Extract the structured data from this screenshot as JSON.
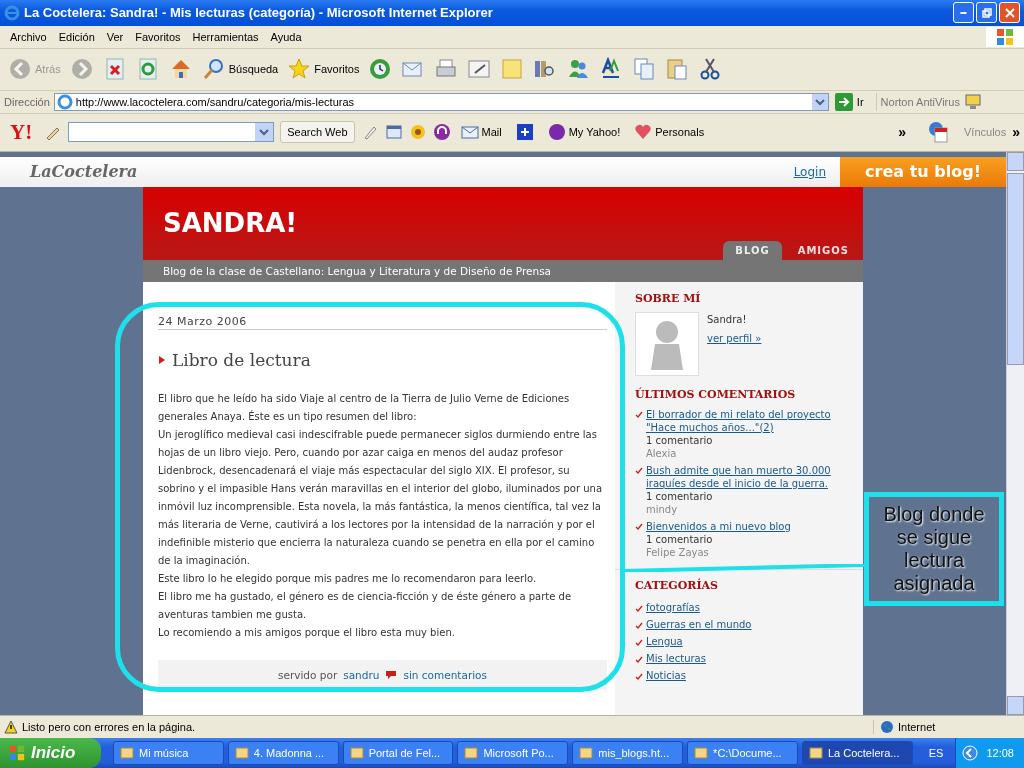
{
  "window": {
    "title": "La Coctelera: Sandra! - Mis lecturas (categoría) - Microsoft Internet Explorer"
  },
  "menu": [
    "Archivo",
    "Edición",
    "Ver",
    "Favoritos",
    "Herramientas",
    "Ayuda"
  ],
  "toolbar": [
    {
      "kind": "back",
      "label": "Atrás",
      "disabled": true
    },
    {
      "kind": "forward",
      "disabled": true
    },
    {
      "kind": "stop",
      "disabled": false
    },
    {
      "kind": "refresh",
      "disabled": false
    },
    {
      "kind": "home",
      "disabled": false
    },
    {
      "kind": "search",
      "label": "Búsqueda",
      "disabled": false
    },
    {
      "kind": "favorites",
      "label": "Favoritos",
      "disabled": false
    },
    {
      "kind": "history",
      "disabled": false
    },
    {
      "kind": "mail",
      "disabled": false
    },
    {
      "kind": "print",
      "disabled": false
    },
    {
      "kind": "edit",
      "disabled": false
    },
    {
      "kind": "note",
      "disabled": false
    },
    {
      "kind": "research",
      "disabled": false
    },
    {
      "kind": "messenger",
      "disabled": false
    },
    {
      "kind": "font",
      "disabled": false
    },
    {
      "kind": "copy",
      "disabled": false
    },
    {
      "kind": "paste",
      "disabled": false
    },
    {
      "kind": "cut",
      "disabled": false
    }
  ],
  "address": {
    "label": "Dirección",
    "url": "http://www.lacoctelera.com/sandru/categoria/mis-lecturas",
    "go": "Ir",
    "addon": "Norton AntiVirus"
  },
  "yahoo": {
    "logo": "Y!",
    "search_button": "Search Web",
    "items": [
      {
        "kind": "mail",
        "label": "Mail"
      },
      {
        "kind": "plus"
      },
      {
        "kind": "myyahoo",
        "label": "My Yahoo!"
      },
      {
        "kind": "personals",
        "label": "Personals"
      }
    ],
    "more": "»",
    "links": "Vínculos",
    "links_more": "»"
  },
  "site": {
    "logo": "LaCoctelera",
    "login": "Login",
    "cta": "crea tu blog!"
  },
  "blog": {
    "title": "SANDRA!",
    "tabs": [
      {
        "label": "BLOG",
        "selected": true
      },
      {
        "label": "AMIGOS",
        "selected": false
      }
    ],
    "subtitle": "Blog de la clase de Castellano: Lengua y Literatura y de Diseño de Prensa"
  },
  "post": {
    "date": "24 Marzo 2006",
    "title": "Libro de lectura",
    "paragraphs": [
      "El libro que he leído ha sido Viaje al centro de la Tierra de Julio Verne de Ediciones generales Anaya. Éste es un tipo resumen del libro:",
      "Un jeroglífico medieval casi indescifrable puede permanecer siglos durmiendo entre las hojas de un libro viejo. Pero, cuando por azar caiga en menos del audaz profesor Lidenbrock, desencadenará el viaje más espectacular del siglo XIX. El profesor, su sobrino y el impasible Hans verán maravillas en el interior del globo, iluminados por una inmóvil luz incomprensible. Esta novela, la más fantástica, la menos científica, tal vez la más literaria de Verne, cautivirá a los lectores por la intensidad de la narración y por el indefinible misterio que encierra la naturaleza cuando se penetra en ella por el camino de la imaginación.",
      "Este libro lo he elegido porque mis padres me lo recomendaron para leerlo.",
      "El libro me ha gustado, el género es de ciencia-ficción y de éste género a parte de aventuras tambien me gusta.",
      "Lo recomiendo a mis amigos porque el libro esta muy bien."
    ],
    "footer": {
      "served_by": "servido por",
      "author": "sandru",
      "comments": "sin comentarios"
    }
  },
  "sidebar": {
    "about": {
      "heading": "SOBRE MÍ",
      "name": "Sandra!",
      "link": "ver perfil »"
    },
    "recent": {
      "heading": "ÚLTIMOS COMENTARIOS",
      "items": [
        {
          "link": "El borrador de mi relato del proyecto \"Hace muchos años...\"(2)",
          "count": "1 comentario",
          "author": "Alexia"
        },
        {
          "link": "Bush admite que han muerto 30.000 iraquíes desde el inicio de la guerra.",
          "count": "1 comentario",
          "author": "mindy"
        },
        {
          "link": "Bienvenidos a mi nuevo blog",
          "count": "1 comentario",
          "author": "Felipe Zayas"
        }
      ]
    },
    "categories": {
      "heading": "CATEGORÍAS",
      "items": [
        "fotografías",
        "Guerras en el mundo",
        "Lengua",
        "Mis lecturas",
        "Noticias"
      ]
    }
  },
  "annotation": {
    "text": "Blog donde se sigue lectura asignada"
  },
  "status_bar": {
    "text": "Listo pero con errores en la página.",
    "zone": "Internet"
  },
  "taskbar": {
    "start": "Inicio",
    "tasks": [
      {
        "label": "Mi música",
        "selected": false
      },
      {
        "label": "4. Madonna ...",
        "selected": false
      },
      {
        "label": "Portal de Fel...",
        "selected": false
      },
      {
        "label": "Microsoft Po...",
        "selected": false
      },
      {
        "label": "mis_blogs.ht...",
        "selected": false
      },
      {
        "label": "*C:\\Docume...",
        "selected": false
      },
      {
        "label": "La Coctelera...",
        "selected": true
      }
    ],
    "language": "ES",
    "clock": "12:08"
  }
}
